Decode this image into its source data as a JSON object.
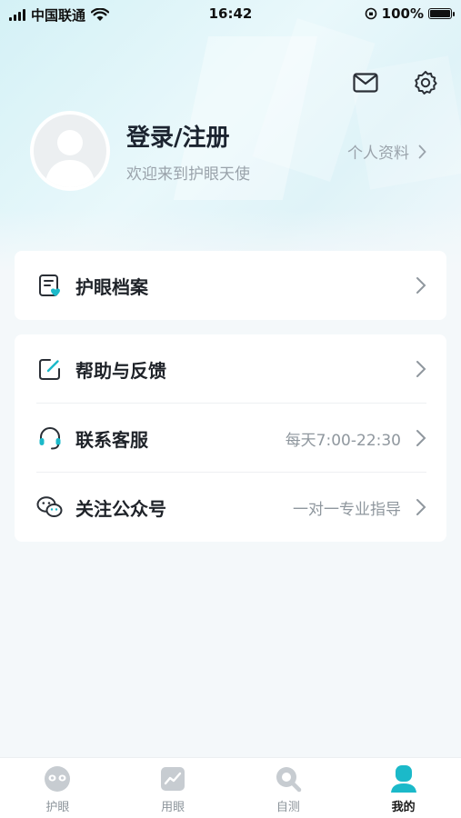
{
  "status_bar": {
    "carrier": "中国联通",
    "time": "16:42",
    "battery": "100%"
  },
  "header": {
    "title": "登录/注册",
    "subtitle": "欢迎来到护眼天使",
    "profile_link": "个人资料"
  },
  "icons": {
    "mail": "mail-icon",
    "settings": "gear-icon"
  },
  "card1": {
    "items": [
      {
        "label": "护眼档案",
        "note": "",
        "icon": "eye-file-icon"
      }
    ]
  },
  "card2": {
    "items": [
      {
        "label": "帮助与反馈",
        "note": "",
        "icon": "edit-feedback-icon"
      },
      {
        "label": "联系客服",
        "note": "每天7:00-22:30",
        "icon": "headset-icon"
      },
      {
        "label": "关注公众号",
        "note": "一对一专业指导",
        "icon": "wechat-icon"
      }
    ]
  },
  "tabbar": {
    "tabs": [
      {
        "label": "护眼",
        "icon": "eye-care-icon",
        "active": false
      },
      {
        "label": "用眼",
        "icon": "chart-icon",
        "active": false
      },
      {
        "label": "自测",
        "icon": "search-icon",
        "active": false
      },
      {
        "label": "我的",
        "icon": "user-icon",
        "active": true
      }
    ]
  },
  "colors": {
    "accent": "#1bb9c9",
    "inactive_tab": "#c7ccd1"
  }
}
